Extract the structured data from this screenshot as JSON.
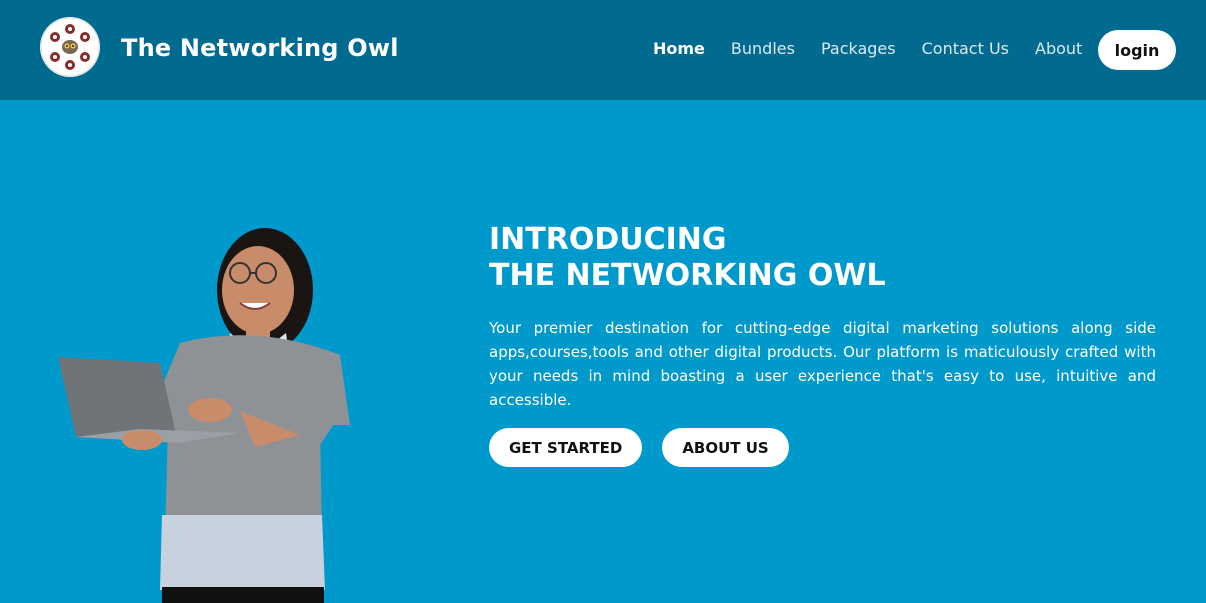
{
  "header": {
    "brand": "The Networking Owl",
    "logo_icon": "owl-logo-icon",
    "nav": [
      {
        "label": "Home",
        "active": true
      },
      {
        "label": "Bundles",
        "active": false
      },
      {
        "label": "Packages",
        "active": false
      },
      {
        "label": "Contact Us",
        "active": false
      },
      {
        "label": "About",
        "active": false
      }
    ],
    "login_label": "login"
  },
  "hero": {
    "title_line1": "INTRODUCING",
    "title_line2": "THE NETWORKING OWL",
    "description": "Your premier destination for cutting-edge digital marketing solutions along side apps,courses,tools and other digital products. Our platform is maticulously crafted with your needs in mind boasting a user experience that's easy to use, intuitive and accessible.",
    "get_started_label": "GET STARTED",
    "about_us_label": "ABOUT US"
  },
  "colors": {
    "header_bg": "#006b8f",
    "hero_bg": "#0099cc",
    "button_bg": "#ffffff"
  }
}
